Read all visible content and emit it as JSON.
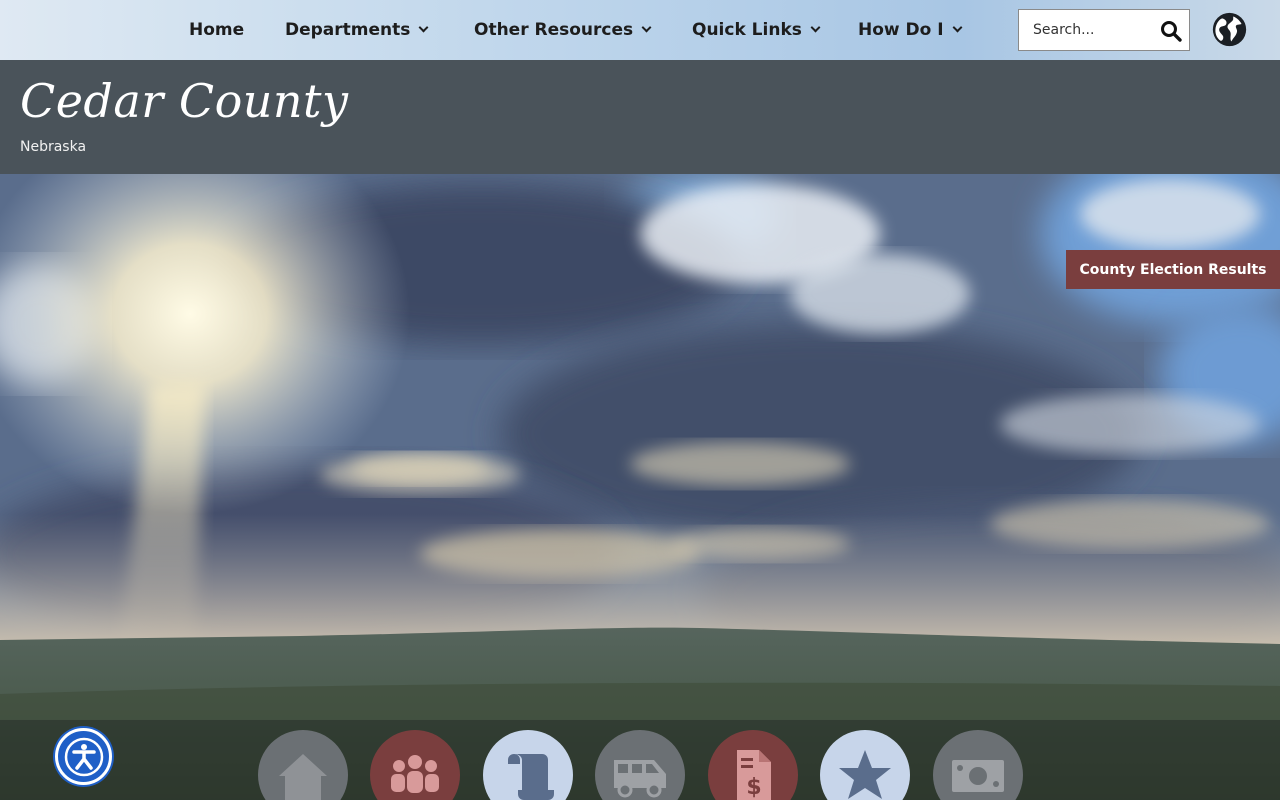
{
  "nav": {
    "home": "Home",
    "departments": "Departments",
    "other_resources": "Other Resources",
    "quick_links": "Quick Links",
    "how_do_i": "How Do I"
  },
  "search": {
    "placeholder": "Search..."
  },
  "header": {
    "title": "Cedar County",
    "subtitle": "Nebraska"
  },
  "hero": {
    "election_button": "County Election Results"
  },
  "quick_icons": [
    {
      "icon": "home-icon",
      "color": "#6b7074"
    },
    {
      "icon": "people-group-icon",
      "color": "#7a3e3e"
    },
    {
      "icon": "scroll-icon",
      "color": "#c7d5ea"
    },
    {
      "icon": "van-icon",
      "color": "#6b7074"
    },
    {
      "icon": "invoice-dollar-icon",
      "color": "#7a3e3e"
    },
    {
      "icon": "star-icon",
      "color": "#c7d5ea"
    },
    {
      "icon": "money-bill-icon",
      "color": "#6b7074"
    }
  ],
  "colors": {
    "header_bg": "#4a535a",
    "accent_red": "#7a3e3e",
    "accessibility_blue": "#1f5fc7"
  }
}
